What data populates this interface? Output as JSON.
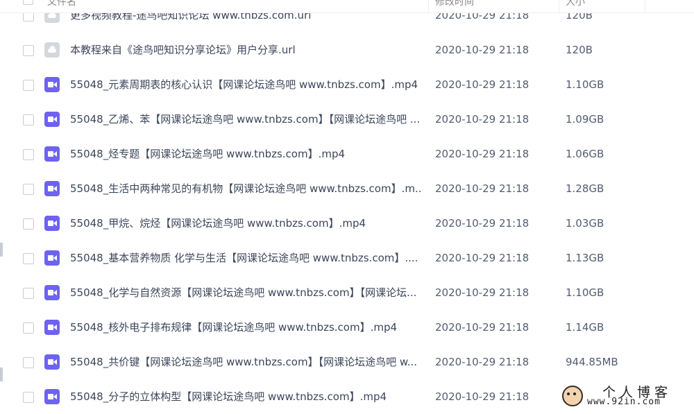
{
  "header": {
    "name_label": "文件名",
    "time_label": "修改时间",
    "size_label": "大小"
  },
  "files": [
    {
      "name": "更多视频教程-途鸟吧知识论坛 www.tnbzs.com.url",
      "time": "2020-10-29 21:18",
      "size": "120B",
      "icon": "cloud-link-icon"
    },
    {
      "name": "本教程来自《途鸟吧知识分享论坛》用户分享.url",
      "time": "2020-10-29 21:18",
      "size": "120B",
      "icon": "cloud-link-icon"
    },
    {
      "name": "55048_元素周期表的核心认识【网课论坛途鸟吧 www.tnbzs.com】.mp4",
      "time": "2020-10-29 21:18",
      "size": "1.10GB",
      "icon": "video-file-icon"
    },
    {
      "name": "55048_乙烯、苯【网课论坛途鸟吧 www.tnbzs.com】【网课论坛途鸟吧 ...",
      "time": "2020-10-29 21:18",
      "size": "1.09GB",
      "icon": "video-file-icon"
    },
    {
      "name": "55048_烃专题【网课论坛途鸟吧 www.tnbzs.com】.mp4",
      "time": "2020-10-29 21:18",
      "size": "1.06GB",
      "icon": "video-file-icon"
    },
    {
      "name": "55048_生活中两种常见的有机物【网课论坛途鸟吧 www.tnbzs.com】.m...",
      "time": "2020-10-29 21:18",
      "size": "1.28GB",
      "icon": "video-file-icon"
    },
    {
      "name": "55048_甲烷、烷烃【网课论坛途鸟吧 www.tnbzs.com】.mp4",
      "time": "2020-10-29 21:18",
      "size": "1.03GB",
      "icon": "video-file-icon"
    },
    {
      "name": "55048_基本营养物质 化学与生活【网课论坛途鸟吧 www.tnbzs.com】....",
      "time": "2020-10-29 21:18",
      "size": "1.13GB",
      "icon": "video-file-icon"
    },
    {
      "name": "55048_化学与自然资源【网课论坛途鸟吧 www.tnbzs.com】【网课论坛...",
      "time": "2020-10-29 21:18",
      "size": "1.10GB",
      "icon": "video-file-icon"
    },
    {
      "name": "55048_核外电子排布规律【网课论坛途鸟吧 www.tnbzs.com】.mp4",
      "time": "2020-10-29 21:18",
      "size": "1.14GB",
      "icon": "video-file-icon"
    },
    {
      "name": "55048_共价键【网课论坛途鸟吧 www.tnbzs.com】【网课论坛途鸟吧 w...",
      "time": "2020-10-29 21:18",
      "size": "944.85MB",
      "icon": "video-file-icon"
    },
    {
      "name": "55048_分子的立体构型【网课论坛途鸟吧 www.tnbzs.com】.mp4",
      "time": "2020-10-29 21:18",
      "size": "",
      "icon": "video-file-icon"
    }
  ],
  "watermark": {
    "title": "个人博客",
    "url": "www.92in.com"
  },
  "colors": {
    "video_icon": "#6e62f0",
    "link_icon": "#d4d8de",
    "sort_accent": "#06a7ff"
  }
}
